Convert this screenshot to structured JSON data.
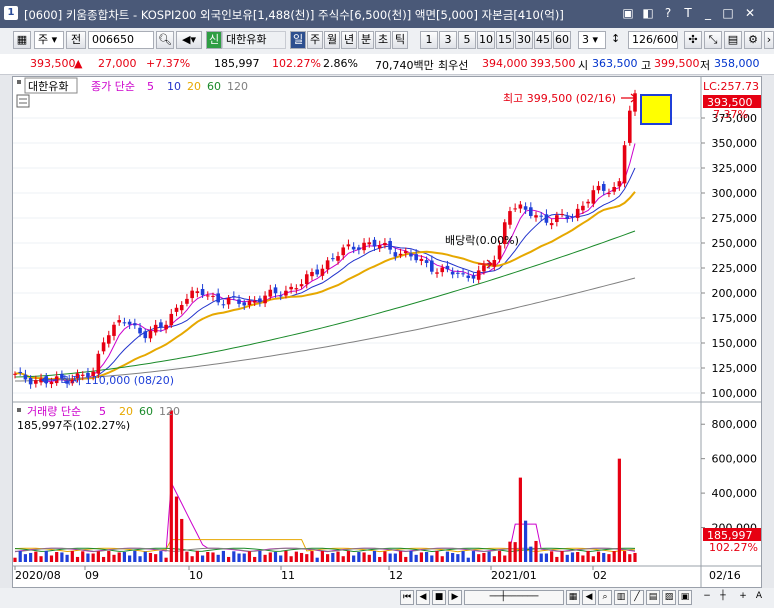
{
  "window": {
    "title": "[0600] 키움종합차트 - KOSPI200 외국인보유[1,488(천)] 주식수[6,500(천)] 액면[5,000] 자본금[410(억)]",
    "app_number": "1"
  },
  "toolbar": {
    "market_type": "주",
    "market_label": "전",
    "stock_code": "006650",
    "credit_badge": "신",
    "stock_name": "대한유화",
    "periods": [
      "일",
      "주",
      "월",
      "년",
      "분",
      "초",
      "틱"
    ],
    "active_period": "일",
    "intervals": [
      "1",
      "3",
      "5",
      "10",
      "15",
      "30",
      "45",
      "60"
    ],
    "interval_value": "3",
    "page_counter": "126/600"
  },
  "quote": {
    "price": "393,500",
    "change_arrow": "▲",
    "change": "27,000",
    "change_pct": "+7.37%",
    "volume": "185,997",
    "volume_ratio": "102.27%",
    "turnover_pct": "2.86%",
    "trade_value": "70,740백만",
    "priority_label": "최우선",
    "ask": "394,000",
    "bid": "393,500",
    "open_label": "시",
    "open": "363,500",
    "high_label": "고",
    "high": "399,500",
    "low_label": "저",
    "low": "358,000"
  },
  "price_panel": {
    "legend_name": "대한유화",
    "legend_ma_label": "종가 단순",
    "ma_periods": [
      "5",
      "10",
      "20",
      "60",
      "120"
    ],
    "ma_colors": [
      "#cc00cc",
      "#2233cc",
      "#e6a800",
      "#1a8a2a",
      "#808080"
    ],
    "lc_label": "LC:257.73",
    "last_price_tag": "393,500",
    "last_pct_tag": "7.37%",
    "high_annotation": "최고 399,500 (02/16)",
    "low_annotation": "최저 110,000 (08/20)",
    "dividend_annotation": "배당락(0.00%)",
    "y_ticks": [
      "375,000",
      "350,000",
      "325,000",
      "300,000",
      "275,000",
      "250,000",
      "225,000",
      "200,000",
      "175,000",
      "150,000",
      "125,000",
      "100,000"
    ]
  },
  "volume_panel": {
    "legend_label": "거래량 단순",
    "ma_periods": [
      "5",
      "20",
      "60",
      "120"
    ],
    "ma_colors": [
      "#cc00cc",
      "#e6a800",
      "#1a8a2a",
      "#808080"
    ],
    "current_volume": "185,997주(102.27%)",
    "last_volume_tag": "185,997",
    "last_pct_tag": "102.27%",
    "y_ticks": [
      "800,000",
      "600,000",
      "400,000",
      "200,000"
    ]
  },
  "x_axis": {
    "labels": [
      "2020/08",
      "09",
      "10",
      "11",
      "12",
      "2021/01",
      "02"
    ],
    "cursor_date": "02/16"
  },
  "colors": {
    "up": "#e60012",
    "down": "#1f3fd8",
    "titlebar": "#4a5978"
  },
  "chart_data": {
    "type": "candlestick",
    "price_series_note_y_unit": "KRW",
    "ylim": [
      100000,
      400000
    ],
    "high": 399500,
    "low": 110000,
    "last_close": 393500,
    "moving_averages": [
      "5",
      "10",
      "20",
      "60",
      "120"
    ],
    "volume_ylim": [
      0,
      900000
    ],
    "last_volume": 185997
  }
}
